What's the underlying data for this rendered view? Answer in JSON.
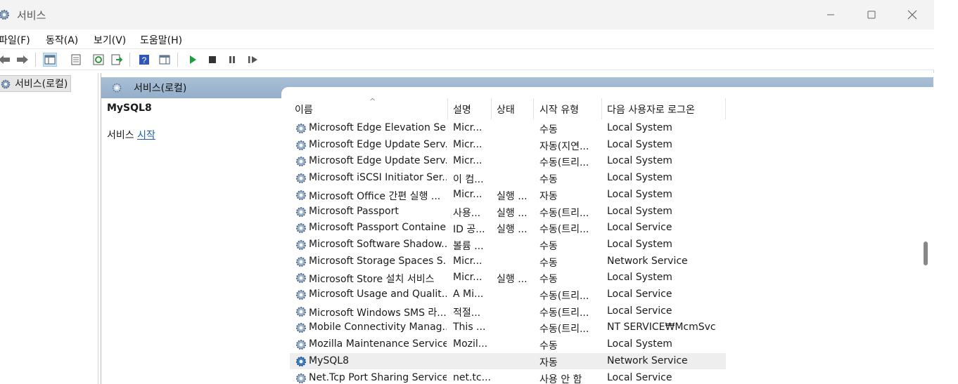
{
  "window": {
    "title": "서비스"
  },
  "menu": [
    "파일(F)",
    "동작(A)",
    "보기(V)",
    "도움말(H)"
  ],
  "tree": {
    "root_label": "서비스(로컬)"
  },
  "main": {
    "header": "서비스(로컬)",
    "selected_service": "MySQL8",
    "action_prefix": "서비스",
    "action_link": "시작"
  },
  "columns": {
    "name": "이름",
    "desc": "설명",
    "status": "상태",
    "start": "시작 유형",
    "logon": "다음 사용자로 로그온"
  },
  "rows": [
    {
      "name": "Microsoft Edge Elevation Se...",
      "desc": "Micr...",
      "status": "",
      "start": "수동",
      "logon": "Local System"
    },
    {
      "name": "Microsoft Edge Update Serv...",
      "desc": "Micr...",
      "status": "",
      "start": "자동(지연...",
      "logon": "Local System"
    },
    {
      "name": "Microsoft Edge Update Serv...",
      "desc": "Micr...",
      "status": "",
      "start": "수동(트리...",
      "logon": "Local System"
    },
    {
      "name": "Microsoft iSCSI Initiator Ser...",
      "desc": "이 컴...",
      "status": "",
      "start": "수동",
      "logon": "Local System"
    },
    {
      "name": "Microsoft Office 간편 실행 ...",
      "desc": "Micr...",
      "status": "실행 ...",
      "start": "자동",
      "logon": "Local System"
    },
    {
      "name": "Microsoft Passport",
      "desc": "사용...",
      "status": "실행 ...",
      "start": "수동(트리...",
      "logon": "Local System"
    },
    {
      "name": "Microsoft Passport Container",
      "desc": "ID 공...",
      "status": "실행 ...",
      "start": "수동(트리...",
      "logon": "Local Service"
    },
    {
      "name": "Microsoft Software Shadow...",
      "desc": "볼륨 ...",
      "status": "",
      "start": "수동",
      "logon": "Local System"
    },
    {
      "name": "Microsoft Storage Spaces S...",
      "desc": "Micr...",
      "status": "",
      "start": "수동",
      "logon": "Network Service"
    },
    {
      "name": "Microsoft Store 설치 서비스",
      "desc": "Micr...",
      "status": "실행 ...",
      "start": "수동",
      "logon": "Local System"
    },
    {
      "name": "Microsoft Usage and Qualit...",
      "desc": "A Mi...",
      "status": "",
      "start": "수동(트리...",
      "logon": "Local Service"
    },
    {
      "name": "Microsoft Windows SMS 라...",
      "desc": "적절...",
      "status": "",
      "start": "수동(트리...",
      "logon": "Local Service"
    },
    {
      "name": "Mobile Connectivity Manag...",
      "desc": "This ...",
      "status": "",
      "start": "수동(트리...",
      "logon": "NT SERVICE₩McmSvc"
    },
    {
      "name": "Mozilla Maintenance Service",
      "desc": "Mozil...",
      "status": "",
      "start": "수동",
      "logon": "Local System"
    },
    {
      "name": "MySQL8",
      "desc": "",
      "status": "",
      "start": "자동",
      "logon": "Network Service",
      "selected": true
    },
    {
      "name": "Net.Tcp Port Sharing Service",
      "desc": "net.tc...",
      "status": "",
      "start": "사용 안 함",
      "logon": "Local Service"
    }
  ],
  "colors": {
    "header_band": "#9fb8d1",
    "selected_row": "#eeeeee",
    "link": "#1a5fb4",
    "play_green": "#1e9e3c"
  }
}
